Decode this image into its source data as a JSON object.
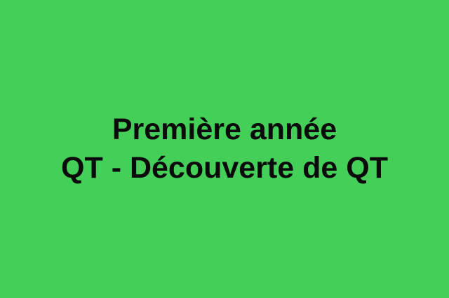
{
  "banner": {
    "line1": "Première année",
    "line2": "QT - Découverte de QT",
    "background_color": "#44cf58",
    "text_color": "#0a0a0a"
  }
}
